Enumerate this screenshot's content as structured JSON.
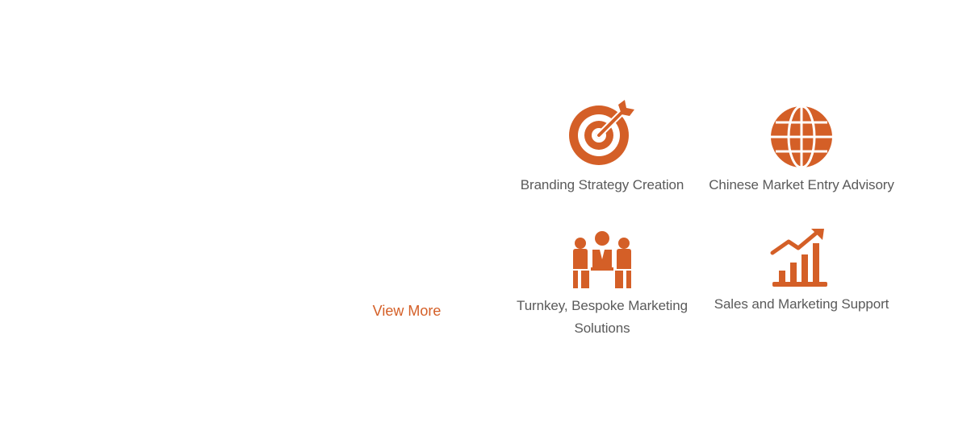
{
  "view_more": {
    "label": "View More"
  },
  "services": [
    {
      "label": "Branding Strategy Creation",
      "icon": "target-arrow-icon"
    },
    {
      "label": "Chinese Market Entry Advisory",
      "icon": "globe-icon"
    },
    {
      "label": "Turnkey, Bespoke Marketing Solutions",
      "icon": "meeting-people-icon"
    },
    {
      "label": "Sales and Marketing Support",
      "icon": "growth-chart-icon"
    }
  ],
  "colors": {
    "accent": "#d45f27",
    "text": "#5a5a5a",
    "background": "#ffffff"
  }
}
